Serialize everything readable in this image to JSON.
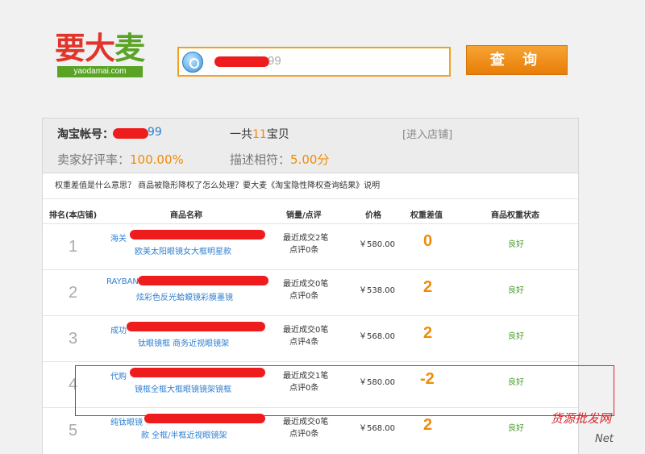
{
  "logo": {
    "text1": "要",
    "text2": "大",
    "text3": "麦",
    "subtitle": "yaodamai.com"
  },
  "search": {
    "value": "99"
  },
  "query_button": "查 询",
  "summary": {
    "account_label": "淘宝帐号：",
    "account_value": "99",
    "total_prefix": "一共",
    "total_count": "11",
    "total_suffix": "宝贝",
    "enter_shop": "[进入店铺]",
    "rate_label": "卖家好评率：",
    "rate_value": "100.00%",
    "desc_label": "描述相符：",
    "desc_value": "5.00分"
  },
  "notice": "权重差值是什么意思？  商品被隐形降权了怎么处理？要大麦《淘宝隐性降权查询结果》说明",
  "columns": {
    "rank": "排名(本店铺)",
    "name": "商品名称",
    "sales": "销量/点评",
    "price": "价格",
    "weight": "权重差值",
    "status": "商品权重状态"
  },
  "rows": [
    {
      "rank": "1",
      "name1": "海关",
      "name2": "欧美太阳眼镜女大框明星款",
      "sales1": "最近成交2笔",
      "sales2": "点评0条",
      "price": "￥580.00",
      "weight": "0",
      "status": "良好"
    },
    {
      "rank": "2",
      "name1": "RAYBAN",
      "name2": "炫彩色反光蛤蟆镜彩膜墨镜",
      "sales1": "最近成交0笔",
      "sales2": "点评0条",
      "price": "￥538.00",
      "weight": "2",
      "status": "良好"
    },
    {
      "rank": "3",
      "name1": "成功",
      "name2": "钛眼镜框 商务近视眼镜架",
      "sales1": "最近成交0笔",
      "sales2": "点评4条",
      "price": "￥568.00",
      "weight": "2",
      "status": "良好"
    },
    {
      "rank": "4",
      "name1": "代购",
      "name2": "镜框全框大框眼镜镜架镜框",
      "sales1": "最近成交1笔",
      "sales2": "点评0条",
      "price": "￥580.00",
      "weight": "-2",
      "status": "良好"
    },
    {
      "rank": "5",
      "name1": "纯钛眼镜",
      "name2": "款 全框/半框近视眼镜架",
      "sales1": "最近成交0笔",
      "sales2": "点评0条",
      "price": "￥568.00",
      "weight": "2",
      "status": "良好"
    }
  ],
  "watermark": {
    "line1": "货源批发网",
    "line2": "Net"
  }
}
